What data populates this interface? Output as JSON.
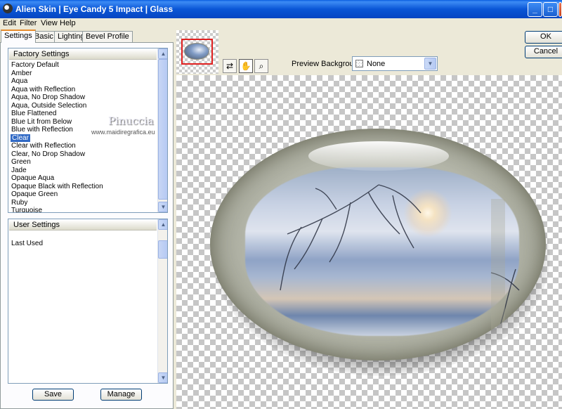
{
  "window": {
    "app_name": "Alien Skin",
    "product": "Eye Candy 5 Impact",
    "filter_name": "Glass",
    "minimize": "_",
    "maximize": "□",
    "close": "x"
  },
  "menu": [
    "Edit",
    "Filter",
    "View",
    "Help"
  ],
  "tabs": [
    "Settings",
    "Basic",
    "Lighting",
    "Bevel Profile"
  ],
  "factory_settings": {
    "header": "Factory Settings",
    "items": [
      "Factory Default",
      "Amber",
      "Aqua",
      "Aqua with Reflection",
      "Aqua, No Drop Shadow",
      "Aqua, Outside Selection",
      "Blue Flattened",
      "Blue Lit from Below",
      "Blue with Reflection",
      "Clear",
      "Clear with Reflection",
      "Clear, No Drop Shadow",
      "Green",
      "Jade",
      "Opaque Aqua",
      "Opaque Black with Reflection",
      "Opaque Green",
      "Ruby",
      "Turquoise"
    ],
    "selected": "Clear"
  },
  "user_settings": {
    "header": "User Settings",
    "items": [
      "Last Used"
    ]
  },
  "buttons": {
    "save": "Save",
    "manage": "Manage",
    "ok": "OK",
    "cancel": "Cancel"
  },
  "watermark": {
    "name": "Pinuccia",
    "site": "www.maidiregrafica.eu"
  },
  "preview": {
    "background_label": "Preview Background:",
    "background_value": "None"
  },
  "icons": {
    "arrow_up": "▲",
    "arrow_down": "▼",
    "tool_toggle": "⇄",
    "tool_hand": "✋",
    "tool_zoom": "⌕"
  }
}
